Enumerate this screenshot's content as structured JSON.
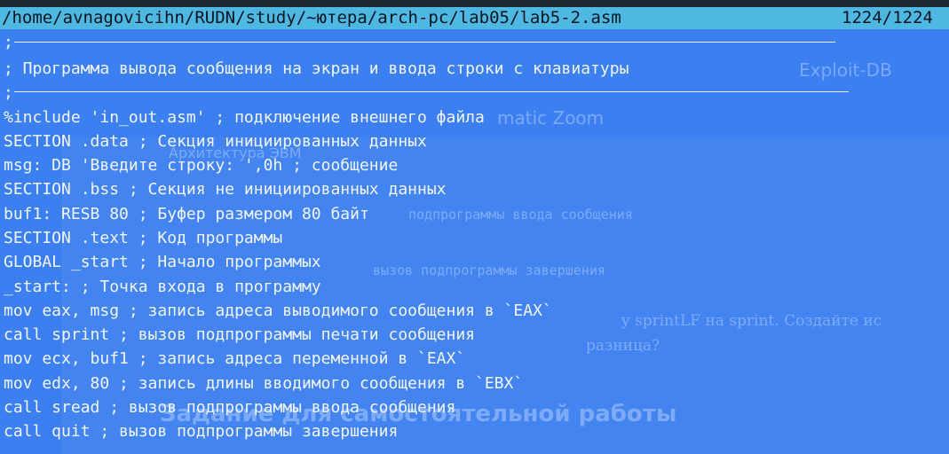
{
  "editor": {
    "file_path": "/home/avnagovicihn/RUDN/study/~ютера/arch-pc/lab05/lab5-2.asm",
    "line_counter": "1224/1224",
    "lines": [
      ";",
      "; Программа вывода сообщения на экран и ввода строки с клавиатуры",
      ";",
      "%include 'in_out.asm' ; подключение внешнего файла",
      "SECTION .data ; Секция инициированных данных",
      "msg: DB 'Введите строку: ',0h ; сообщение",
      "SECTION .bss ; Секция не инициированных данных",
      "buf1: RESB 80 ; Буфер размером 80 байт",
      "SECTION .text ; Код программы",
      "GLOBAL _start ; Начало программых",
      "_start: ; Точка входа в программу",
      "mov eax, msg ; запись адреса выводимого сообщения в `EAX`",
      "call sprint ; вызов подпрограммы печати сообщения",
      "mov ecx, buf1 ; запись адреса переменной в `EAX`",
      "mov edx, 80 ; запись длины вводимого сообщения в `EBX`",
      "call sread ; вызов подпрограммы ввода сообщения",
      "call quit ; вызов подпрограммы завершения"
    ]
  },
  "background_window": {
    "tab_exploit_db": "Exploit-DB",
    "zoom_label": "matic Zoom",
    "heading_fragment": "Архитектура ЭВМ",
    "code_comment_1": "подпрограммы ввода сообщения",
    "code_comment_2": "вызов подпрограммы завершения",
    "text_fragment_1": "y sprintLF на sprint. Создайте ис",
    "text_fragment_2": "разница?",
    "section_title": "Задание для самостоятельной работы"
  },
  "colors": {
    "editor_background": "#3c7ff0",
    "path_bar": "#4eb8e2",
    "text": "#f1f6ff"
  }
}
